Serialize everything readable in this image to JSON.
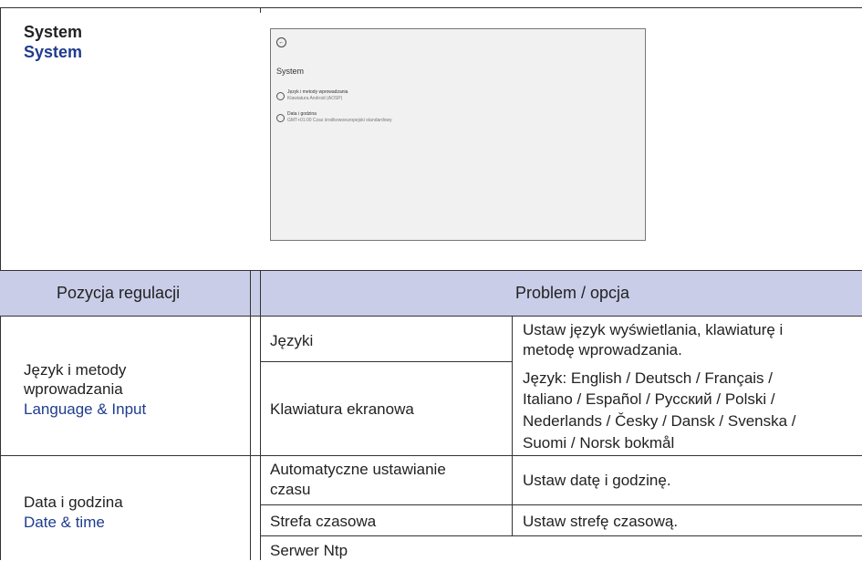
{
  "section": {
    "title": "System",
    "subtitle": "System"
  },
  "screenshot": {
    "back_glyph": "←",
    "title": "System",
    "items": [
      {
        "icon": "globe-icon",
        "title": "Język i metody wprowadzania",
        "subtitle": "Klawiatura Android (AOSP)"
      },
      {
        "icon": "clock-icon",
        "title": "Data i godzina",
        "subtitle": "GMT+01:00 Czas środkowoeuropejski standardowy"
      }
    ]
  },
  "table": {
    "headers": {
      "col1": "Pozycja regulacji",
      "col2": "Problem / opcja"
    },
    "colors": {
      "header_bg": "#c9cde8",
      "accent": "#1f3c8e"
    },
    "language": {
      "label": "Język i metody",
      "label2": "wprowadzania",
      "english": "Language & Input",
      "rows": [
        {
          "item": "Języki",
          "desc_line1": "Ustaw język wyświetlania, klawiaturę i",
          "desc_line2": "metodę wprowadzania."
        },
        {
          "item": "Klawiatura ekranowa",
          "desc_lines": [
            "Język:  English / Deutsch / Français /",
            "Italiano / Español / Русский / Polski /",
            "Nederlands / Česky / Dansk / Svenska /",
            "Suomi / Norsk bokmål"
          ]
        }
      ]
    },
    "datetime": {
      "label": "Data i godzina",
      "english": "Date & time",
      "rows": [
        {
          "item_line1": "Automatyczne ustawianie",
          "item_line2": "czasu",
          "desc": "Ustaw datę i godzinę."
        },
        {
          "item": "Strefa czasowa",
          "desc": "Ustaw strefę czasową."
        },
        {
          "item": "Serwer Ntp"
        }
      ]
    }
  }
}
